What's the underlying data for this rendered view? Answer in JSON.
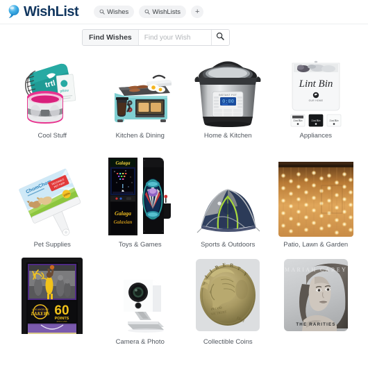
{
  "header": {
    "brand_name": "WishList",
    "logo_icon": "speech-bubble-icon",
    "nav_pills": [
      {
        "label": "Wishes",
        "icon": "search-icon"
      },
      {
        "label": "WishLists",
        "icon": "search-icon"
      },
      {
        "label": "+",
        "icon": "plus-icon"
      }
    ]
  },
  "search": {
    "button_label": "Find Wishes",
    "placeholder": "Find your Wish",
    "value": "",
    "submit_icon": "search-icon"
  },
  "grid": {
    "rows": [
      {
        "tiles": [
          {
            "label": "Cool Stuff",
            "image": "travel-pillow-teal-bag"
          },
          {
            "label": "Kitchen & Dining",
            "image": "3-in-1-breakfast-station-teal"
          },
          {
            "label": "Home & Kitchen",
            "image": "instant-pot-pressure-cooker"
          },
          {
            "label": "Appliances",
            "image": "lint-bin-white-wall-container"
          }
        ]
      },
      {
        "tiles": [
          {
            "label": "Pet Supplies",
            "image": "pet-hair-lint-roller"
          },
          {
            "label": "Toys & Games",
            "image": "galaga-arcade-cabinet"
          },
          {
            "label": "Sports & Outdoors",
            "image": "blue-dome-camping-tent"
          },
          {
            "label": "Patio, Lawn & Garden",
            "image": "warm-white-curtain-string-lights"
          }
        ]
      },
      {
        "tiles": [
          {
            "label": "",
            "image": "kobe-bryant-lakers-60-points-frame"
          },
          {
            "label": "Camera & Photo",
            "image": "white-security-camera"
          },
          {
            "label": "Collectible Coins",
            "image": "mercury-dime-silver-coin"
          },
          {
            "label": "",
            "image": "mariah-carey-the-rarities-album"
          }
        ]
      }
    ]
  },
  "colors": {
    "brand_navy": "#11365f",
    "logo_blue": "#29a3e0",
    "pill_bg": "#f1f2f4",
    "label_text": "#50565e",
    "border": "#d9dbdf"
  }
}
